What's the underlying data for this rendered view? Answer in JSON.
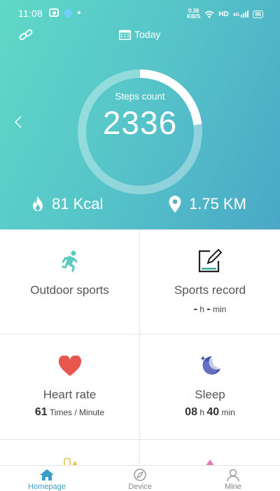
{
  "status_bar": {
    "time": "11:08",
    "net_speed_value": "0.36",
    "net_speed_unit": "KB/S",
    "network": "HD",
    "signal": "4G",
    "battery": "96"
  },
  "header": {
    "date_label": "Today"
  },
  "steps": {
    "label": "Steps count",
    "value": "2336",
    "goal_progress": 0.23
  },
  "summary": {
    "kcal": "81 Kcal",
    "distance": "1.75 KM"
  },
  "cards": {
    "outdoor": {
      "title": "Outdoor sports"
    },
    "record": {
      "title": "Sports record",
      "hours": "-",
      "h_unit": "h",
      "minutes": "-",
      "min_unit": "min"
    },
    "heart": {
      "title": "Heart rate",
      "value": "61",
      "unit": "Times / Minute"
    },
    "sleep": {
      "title": "Sleep",
      "hours": "08",
      "h_unit": "h",
      "minutes": "40",
      "min_unit": "min"
    }
  },
  "tabs": [
    {
      "label": "Homepage"
    },
    {
      "label": "Device"
    },
    {
      "label": "Mine"
    }
  ],
  "colors": {
    "hero_start": "#5fd8c6",
    "hero_end": "#4aa8c6",
    "heart": "#e8574e",
    "runner": "#5ccbbd",
    "sleep": "#3c4aa8",
    "tab_active": "#3a9fc7"
  }
}
